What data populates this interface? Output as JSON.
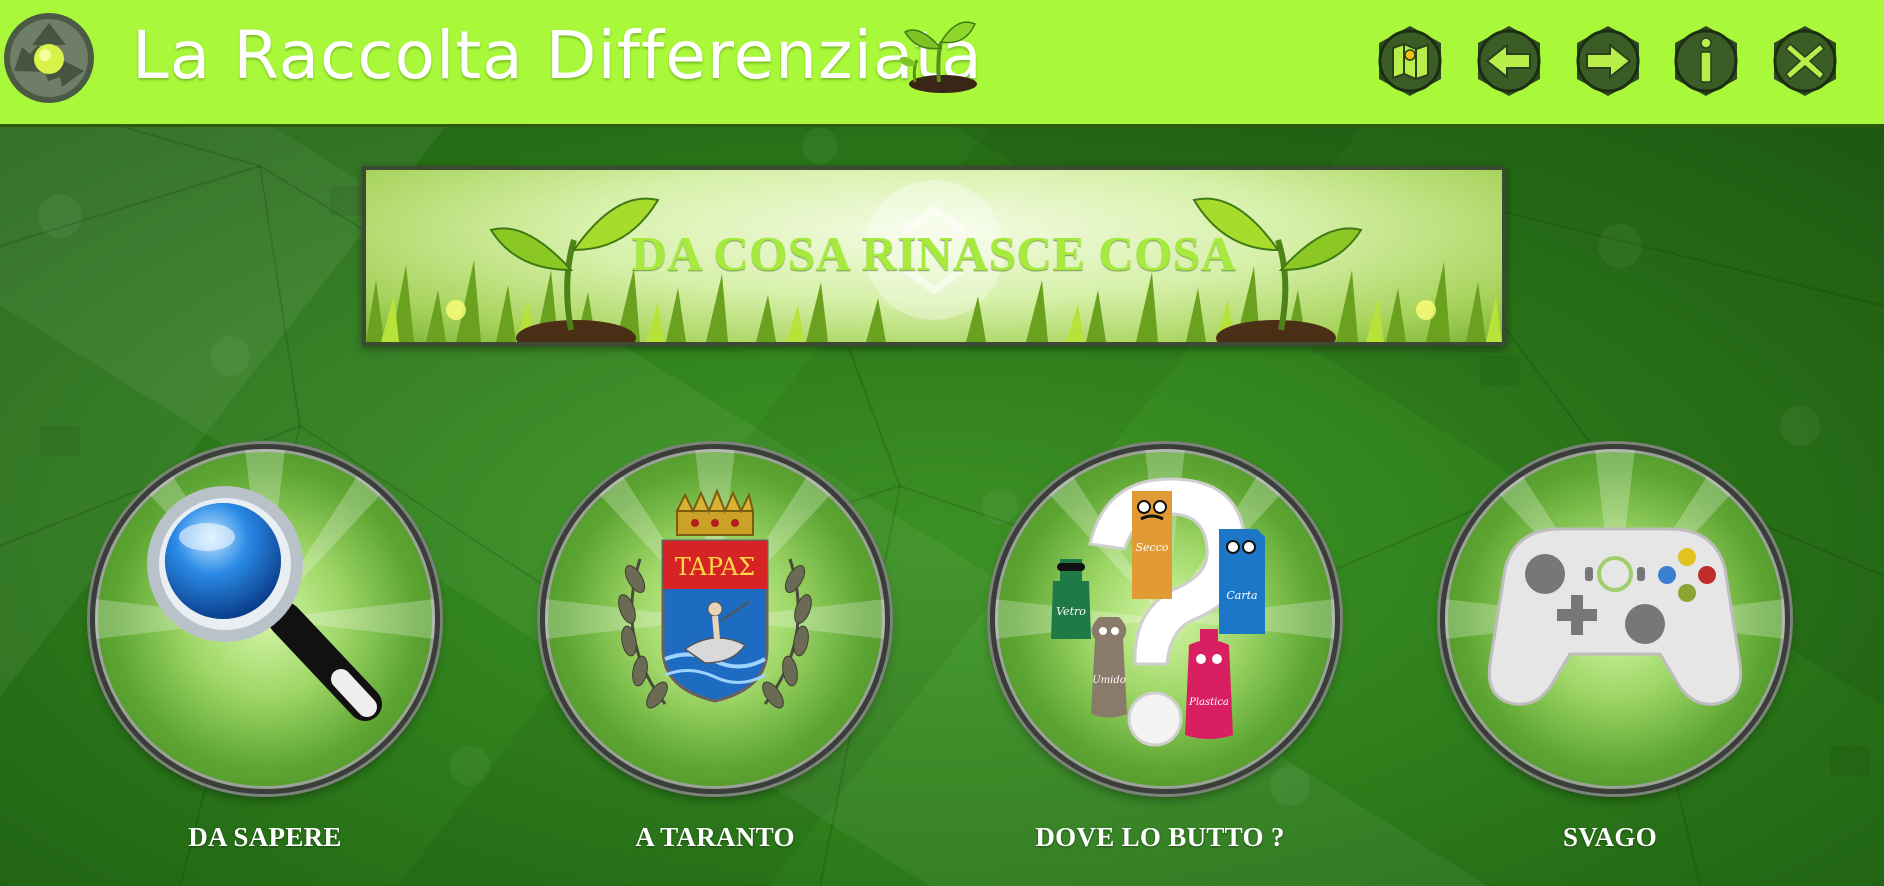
{
  "header": {
    "title": "La Raccolta Differenziata",
    "buttons": [
      {
        "name": "map-button",
        "icon": "map-icon"
      },
      {
        "name": "back-button",
        "icon": "arrow-left-icon"
      },
      {
        "name": "forward-button",
        "icon": "arrow-right-icon"
      },
      {
        "name": "info-button",
        "icon": "info-icon"
      },
      {
        "name": "close-button",
        "icon": "close-icon"
      }
    ],
    "bg_color": "#a9f83a"
  },
  "banner": {
    "title": "DA COSA RINASCE COSA"
  },
  "tiles": [
    {
      "label": "DA SAPERE",
      "icon": "magnifier-icon"
    },
    {
      "label": "A TARANTO",
      "icon": "taranto-coat-of-arms-icon",
      "shield_text": "TAPAΣ"
    },
    {
      "label": "DOVE LO BUTTO ?",
      "icon": "waste-bins-question-icon",
      "bins": [
        "Vetro",
        "Secco",
        "Carta",
        "Umido",
        "Plastica"
      ]
    },
    {
      "label": "SVAGO",
      "icon": "gamepad-icon"
    }
  ],
  "colors": {
    "accent": "#a9f83a",
    "background": "#2f7d1e",
    "banner_text": "#a5ea3c"
  }
}
